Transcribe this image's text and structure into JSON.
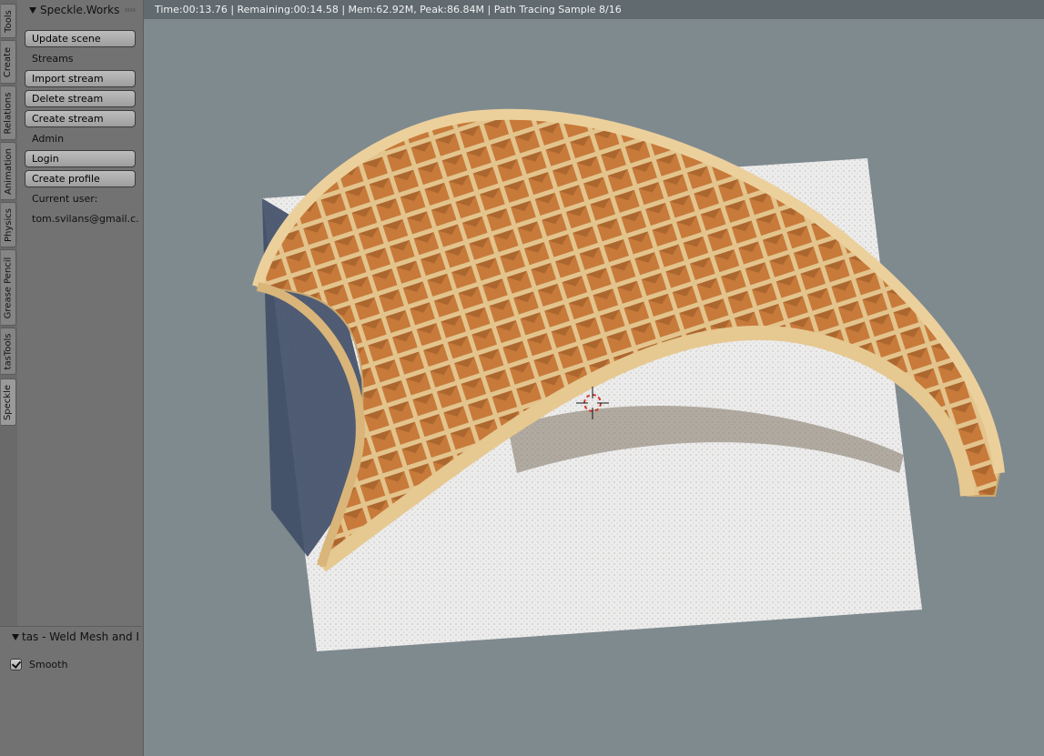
{
  "tabs": [
    {
      "label": "Tools",
      "active": false
    },
    {
      "label": "Create",
      "active": false
    },
    {
      "label": "Relations",
      "active": false
    },
    {
      "label": "Animation",
      "active": false
    },
    {
      "label": "Physics",
      "active": false
    },
    {
      "label": "Grease Pencil",
      "active": false
    },
    {
      "label": "tasTools",
      "active": false
    },
    {
      "label": "Speckle",
      "active": true
    }
  ],
  "panel": {
    "title": "Speckle.Works",
    "update_scene": "Update scene",
    "streams_label": "Streams",
    "import_stream": "Import stream",
    "delete_stream": "Delete stream",
    "create_stream": "Create stream",
    "admin_label": "Admin",
    "login": "Login",
    "create_profile": "Create profile",
    "current_user_label": "Current user:",
    "current_user": "tom.svilans@gmail.c..."
  },
  "operator_panel": {
    "title": "tas - Weld Mesh and Ed",
    "smooth_label": "Smooth",
    "smooth_checked": true
  },
  "viewport": {
    "status": "Time:00:13.76 | Remaining:00:14.58 | Mem:62.92M, Peak:86.84M | Path Tracing Sample 8/16"
  },
  "colors": {
    "viewport_bg": "#7f8a8f",
    "wood": "#e3c48d",
    "ground": "#ecedec"
  }
}
